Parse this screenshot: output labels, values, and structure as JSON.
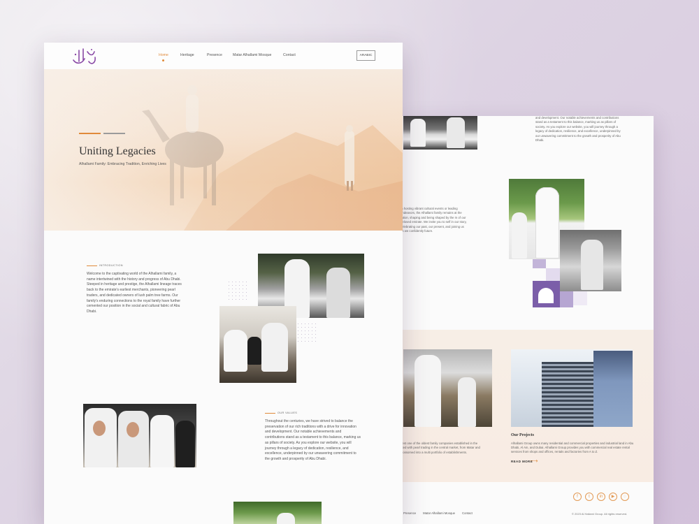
{
  "front": {
    "nav": {
      "items": [
        "Home",
        "Heritage",
        "Presence",
        "Matar Alhallami Mosque",
        "Contact"
      ],
      "language_button": "ARABIC"
    },
    "hero": {
      "title": "Uniting Legacies",
      "subtitle": "Alhallami Family: Embracing Tradition, Enriching Lives"
    },
    "intro": {
      "label": "INTRODUCTION",
      "text": "Welcome to the captivating world of the Alhallami family, a name intertwined with the history and progress of Abu Dhabi. Steeped in heritage and prestige, the Alhallami lineage traces back to the emirate's earliest merchants, pioneering pearl traders, and dedicated owners of lush palm tree farms. Our family's enduring connections to the royal family have further cemented our position in the social and cultural fabric of Abu Dhabi."
    },
    "values": {
      "label": "OUR VALUES",
      "text": "Throughout the centuries, we have strived to balance the preservation of our rich traditions with a drive for innovation and development. Our notable achievements and contributions stand as a testament to this balance, marking us as pillars of society. As you explore our website, you will journey through a legacy of dedication, resilience, and excellence, underpinned by our unwavering commitment to the growth and prosperity of Abu Dhabi."
    }
  },
  "back": {
    "top_text": "and development. Our notable achievements and contributions stand as a testament to this balance, marking us as pillars of society. As you explore our website, you will journey through a legacy of dedication, resilience, and excellence, underpinned by our unwavering commitment to the growth and prosperity of Abu Dhabi.",
    "mid_text": "m hosting vibrant cultural events or leading endeavors, the Alhallami family remains at the ration, shaping and being shaped by the m of our beloved emirate. We invite you to self in our story, celebrating our past, our present, and joining us as we confidently future.",
    "band_left_text": "dest one of the oldest family companies established in the nted with pearl trading in the central market, from Matar and blossomed into a multi portfolio of establishments.",
    "projects": {
      "title": "Our Projects",
      "text": "Alhallami Group owns many residential and commercial properties and industrial land in Abu Dhabi, Al Ain, and Dubai. Alhallami Group provides you with commercial real estate rental services from shops and offices, rentals and factories from A to Z.",
      "read_more": "READ MORE"
    },
    "footer": {
      "nav": [
        "Presence",
        "Matar Alhallami Mosque",
        "Contact"
      ],
      "copyright": "© 2023 Al Hallami Group. All rights reserved.",
      "social_icons": [
        "facebook-icon",
        "twitter-icon",
        "linkedin-icon",
        "youtube-icon",
        "snapchat-icon"
      ]
    }
  },
  "colors": {
    "accent": "#e08a3a",
    "purple": "#7b5ea9",
    "logo": "#8a4aa6"
  }
}
